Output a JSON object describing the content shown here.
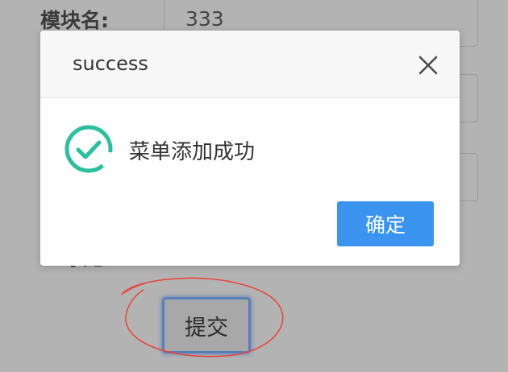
{
  "form": {
    "module_name_label": "模块名:",
    "module_name_value": "333",
    "hidden_label": "状态",
    "submit_label": "提交"
  },
  "dialog": {
    "title": "success",
    "message": "菜单添加成功",
    "confirm_label": "确定",
    "close_icon": "close-icon",
    "status_icon": "check-circle-icon"
  },
  "colors": {
    "accent": "#3b95f0",
    "success": "#2bbf9e",
    "annotation": "#e8443a"
  }
}
